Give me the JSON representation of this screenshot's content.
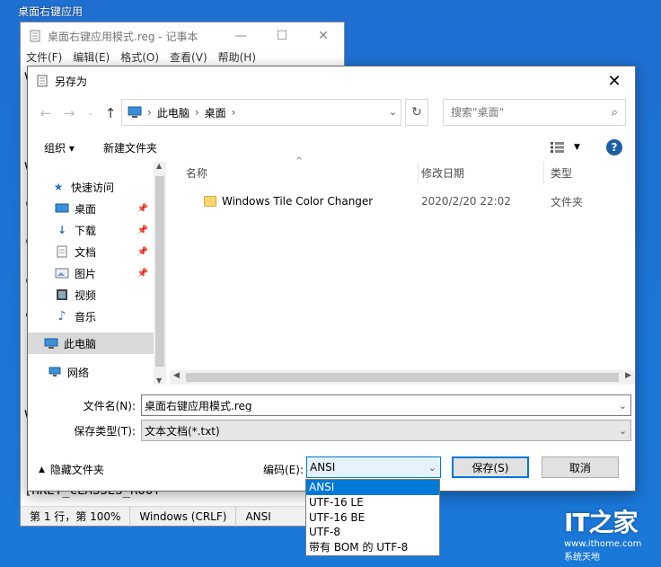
{
  "desktop": {
    "label": "桌面右键应用"
  },
  "notepad": {
    "title": "桌面右键应用模式.reg - 记事本",
    "menu": [
      "文件(F)",
      "编辑(E)",
      "格式(O)",
      "查看(V)",
      "帮助(H)"
    ],
    "peek_lines": [
      "V",
      "[",
      "V",
      "\"",
      "\"",
      "\"",
      "\"",
      "[",
      "V"
    ],
    "bottom_line": "[HKEY_CLASSES_ROOT",
    "status": [
      "第 1 行，第 100%",
      "Windows (CRLF)",
      "ANSI"
    ]
  },
  "dialog": {
    "title": "另存为",
    "address": {
      "segments": [
        "此电脑",
        "桌面"
      ]
    },
    "search": {
      "placeholder": "搜索\"桌面\""
    },
    "toolbar": {
      "organize": "组织 ▾",
      "new_folder": "新建文件夹"
    },
    "nav": [
      {
        "label": "快速访问",
        "icon": "star-icon"
      },
      {
        "label": "桌面",
        "icon": "desktop-icon",
        "pinned": true
      },
      {
        "label": "下载",
        "icon": "download-icon",
        "pinned": true
      },
      {
        "label": "文档",
        "icon": "document-icon",
        "pinned": true
      },
      {
        "label": "图片",
        "icon": "picture-icon",
        "pinned": true
      },
      {
        "label": "视频",
        "icon": "video-icon"
      },
      {
        "label": "音乐",
        "icon": "music-icon"
      },
      {
        "label": "此电脑",
        "icon": "computer-icon",
        "selected": true
      },
      {
        "label": "网络",
        "icon": "network-icon"
      }
    ],
    "columns": [
      "名称",
      "修改日期",
      "类型"
    ],
    "files": [
      {
        "name": "Windows Tile Color Changer",
        "date": "2020/2/20 22:02",
        "type": "文件夹"
      }
    ],
    "filename_label": "文件名(N):",
    "filename_value": "桌面右键应用模式.reg",
    "filetype_label": "保存类型(T):",
    "filetype_value": "文本文档(*.txt)",
    "hide_folders": "隐藏文件夹",
    "encoding_label": "编码(E):",
    "encoding_value": "ANSI",
    "save": "保存(S)",
    "cancel": "取消"
  },
  "encoding_options": [
    "ANSI",
    "UTF-16 LE",
    "UTF-16 BE",
    "UTF-8",
    "带有 BOM 的 UTF-8"
  ],
  "watermark": {
    "brand": "IT之家",
    "url": "www.ithome.com",
    "sub": "系统天地"
  },
  "colors": {
    "desktop": "#1f6fd1",
    "accent": "#0078d7",
    "folder": "#f6d574"
  }
}
